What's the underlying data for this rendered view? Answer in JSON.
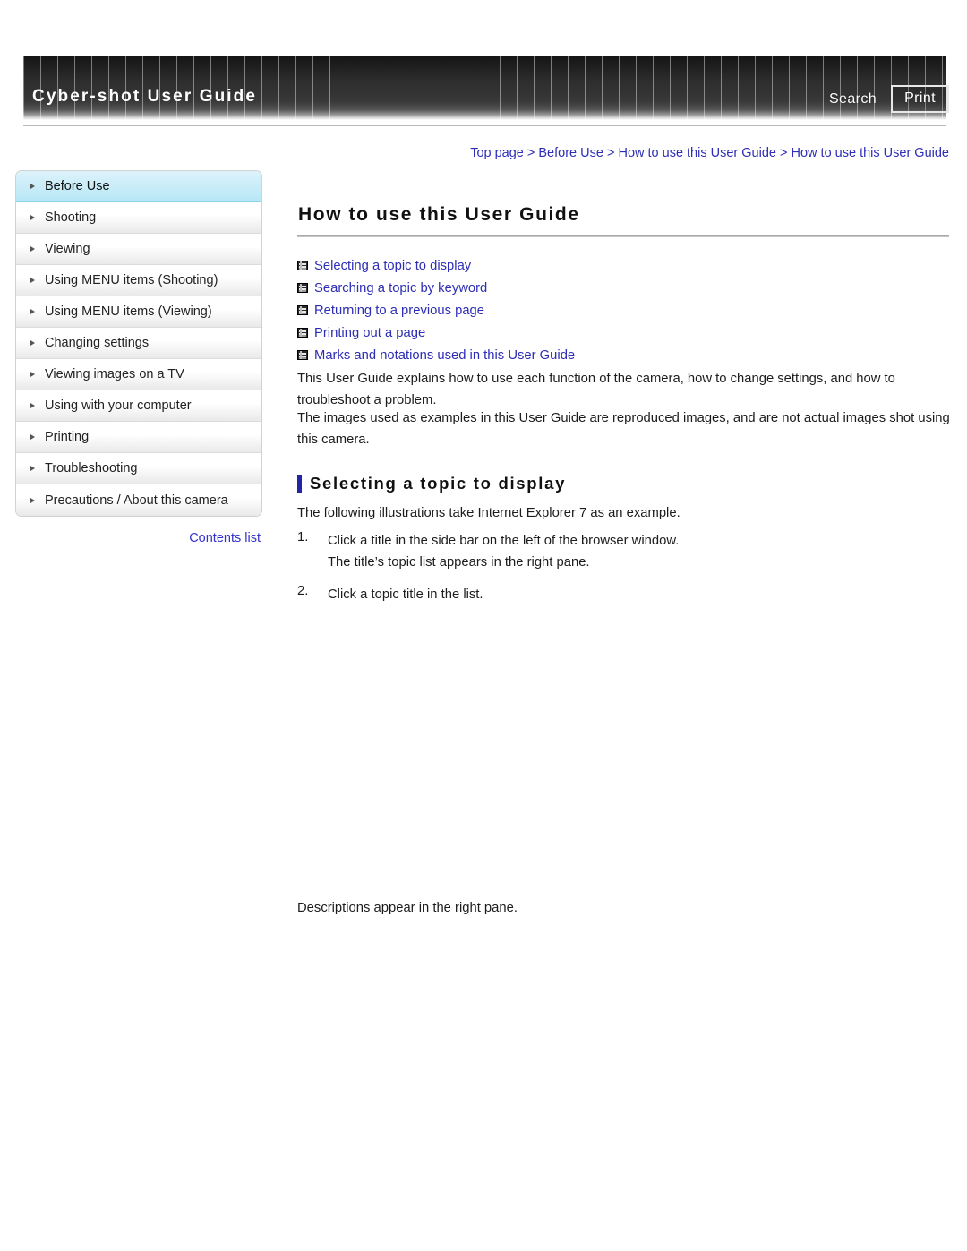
{
  "header": {
    "brand_title": "Cyber-shot User Guide",
    "search_label": "Search",
    "print_label": "Print"
  },
  "sidebar": {
    "items": [
      {
        "label": "Before Use",
        "active": true
      },
      {
        "label": "Shooting",
        "active": false
      },
      {
        "label": "Viewing",
        "active": false
      },
      {
        "label": "Using MENU items (Shooting)",
        "active": false
      },
      {
        "label": "Using MENU items (Viewing)",
        "active": false
      },
      {
        "label": "Changing settings",
        "active": false
      },
      {
        "label": "Viewing images on a TV",
        "active": false
      },
      {
        "label": "Using with your computer",
        "active": false
      },
      {
        "label": "Printing",
        "active": false
      },
      {
        "label": "Troubleshooting",
        "active": false
      },
      {
        "label": "Precautions / About this camera",
        "active": false
      }
    ],
    "contents_list_label": "Contents list"
  },
  "breadcrumb": {
    "separator": " > ",
    "crumbs": [
      "Top page",
      "Before Use",
      "How to use this User Guide",
      "How to use this User Guide"
    ]
  },
  "main": {
    "page_title": "How to use this User Guide",
    "anchor_links": [
      {
        "label": "Selecting a topic to display",
        "icon": "jump-anchor-icon"
      },
      {
        "label": "Searching a topic by keyword",
        "icon": "jump-anchor-icon"
      },
      {
        "label": "Returning to a previous page",
        "icon": "jump-anchor-icon"
      },
      {
        "label": "Printing out a page",
        "icon": "jump-anchor-icon"
      },
      {
        "label": "Marks and notations used in this User Guide",
        "icon": "jump-anchor-icon"
      }
    ],
    "paragraph_1": "This User Guide explains how to use each function of the camera, how to change settings, and how to troubleshoot a problem.",
    "paragraph_2": "The images used as examples in this User Guide are reproduced images, and are not actual images shot using this camera.",
    "section_heading": "Selecting a topic to display",
    "intro_line": "The following illustrations take Internet Explorer 7 as an example.",
    "steps": [
      {
        "number": "1.",
        "text": "Click a title in the side bar on the left of the browser window.",
        "subtext": "The title’s topic list appears in the right pane."
      },
      {
        "number": "2.",
        "text": "Click a topic title in the list.",
        "subtext": ""
      }
    ],
    "closing_line": "Descriptions appear in the right pane."
  },
  "colors": {
    "link": "#2d2db5",
    "accent_bar": "#2424a8",
    "active_nav": "#c2ebf7",
    "header_dark": "#1d1d1d"
  }
}
